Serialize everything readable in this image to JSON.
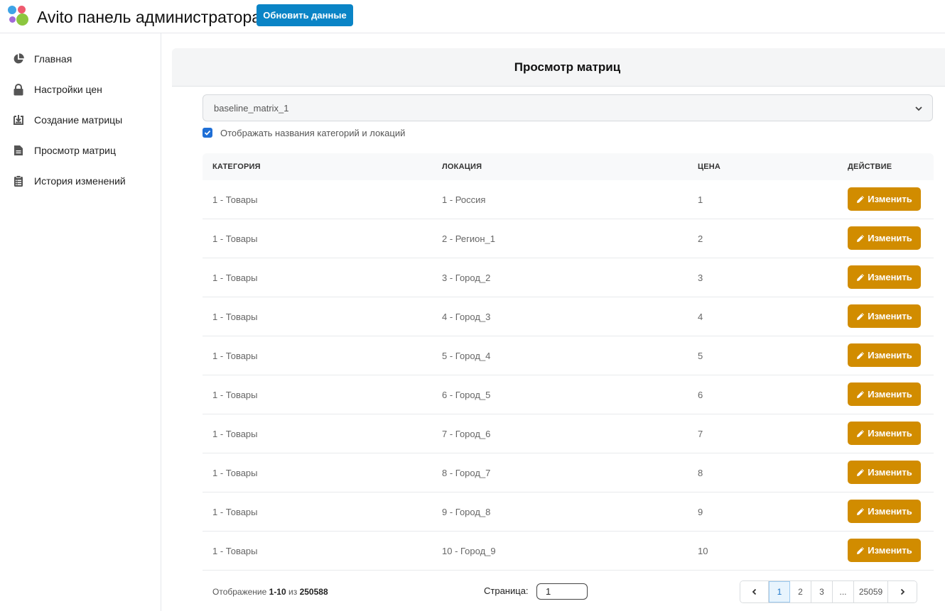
{
  "header": {
    "title": "Avito панель администратора",
    "refresh_label": "Обновить данные"
  },
  "sidebar": {
    "items": [
      {
        "label": "Главная",
        "icon": "pie-chart-icon"
      },
      {
        "label": "Настройки цен",
        "icon": "lock-icon"
      },
      {
        "label": "Создание матрицы",
        "icon": "download-box-icon"
      },
      {
        "label": "Просмотр матриц",
        "icon": "file-icon"
      },
      {
        "label": "История изменений",
        "icon": "clipboard-icon"
      }
    ]
  },
  "main": {
    "title": "Просмотр матриц",
    "select_value": "baseline_matrix_1",
    "checkbox_label": "Отображать названия категорий и локаций",
    "checkbox_checked": true
  },
  "table": {
    "headers": [
      "КАТЕГОРИЯ",
      "ЛОКАЦИЯ",
      "ЦЕНА",
      "ДЕЙСТВИЕ"
    ],
    "edit_label": "Изменить",
    "rows": [
      {
        "category": "1 - Товары",
        "location": "1 - Россия",
        "price": "1"
      },
      {
        "category": "1 - Товары",
        "location": "2 - Регион_1",
        "price": "2"
      },
      {
        "category": "1 - Товары",
        "location": "3 - Город_2",
        "price": "3"
      },
      {
        "category": "1 - Товары",
        "location": "4 - Город_3",
        "price": "4"
      },
      {
        "category": "1 - Товары",
        "location": "5 - Город_4",
        "price": "5"
      },
      {
        "category": "1 - Товары",
        "location": "6 - Город_5",
        "price": "6"
      },
      {
        "category": "1 - Товары",
        "location": "7 - Город_6",
        "price": "7"
      },
      {
        "category": "1 - Товары",
        "location": "8 - Город_7",
        "price": "8"
      },
      {
        "category": "1 - Товары",
        "location": "9 - Город_8",
        "price": "9"
      },
      {
        "category": "1 - Товары",
        "location": "10 - Город_9",
        "price": "10"
      }
    ]
  },
  "footer": {
    "showing_prefix": "Отображение",
    "showing_range": "1-10",
    "showing_of": "из",
    "showing_total": "250588",
    "page_label": "Страница:",
    "page_value": "1",
    "pages": [
      "1",
      "2",
      "3",
      "...",
      "25059"
    ],
    "active_page": "1"
  },
  "colors": {
    "accent_blue": "#0a84c6",
    "edit_button": "#d18c00",
    "checkbox": "#1f6fd6"
  }
}
